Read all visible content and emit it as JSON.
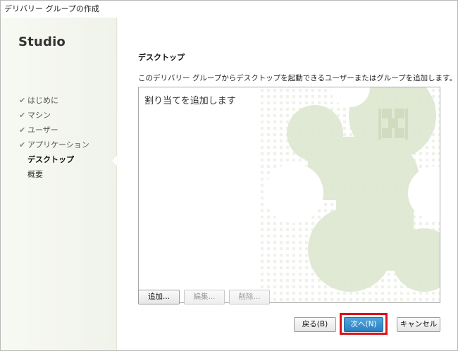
{
  "window": {
    "title": "デリバリー グループの作成"
  },
  "sidebar": {
    "brand": "Studio",
    "steps": [
      {
        "label": "はじめに",
        "state": "done"
      },
      {
        "label": "マシン",
        "state": "done"
      },
      {
        "label": "ユーザー",
        "state": "done"
      },
      {
        "label": "アプリケーション",
        "state": "done"
      },
      {
        "label": "デスクトップ",
        "state": "current"
      },
      {
        "label": "概要",
        "state": "pending"
      }
    ],
    "check_glyph": "✔"
  },
  "main": {
    "section_title": "デスクトップ",
    "description": "このデリバリー グループからデスクトップを起動できるユーザーまたはグループを追加します。",
    "list_placeholder": "割り当てを追加します",
    "list_buttons": {
      "add": "追加...",
      "edit": "編集...",
      "remove": "削除..."
    }
  },
  "footer": {
    "back": "戻る(B)",
    "next": "次へ(N)",
    "cancel": "キャンセル"
  },
  "colors": {
    "accent": "#2b7fc0",
    "highlight": "#d8141a",
    "watermark": "#dfe8d2"
  }
}
